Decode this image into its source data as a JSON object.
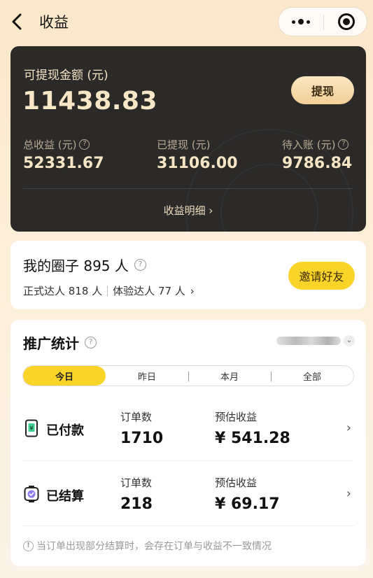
{
  "header": {
    "title": "收益",
    "more_icon": "more-dots-icon",
    "close_icon": "target-icon"
  },
  "earnings": {
    "available_label": "可提现金额 (元)",
    "available_amount": "11438.83",
    "withdraw_label": "提现",
    "stats": [
      {
        "label": "总收益 (元)",
        "value": "52331.67",
        "has_help": true
      },
      {
        "label": "已提现 (元)",
        "value": "31106.00",
        "has_help": false
      },
      {
        "label": "待入账 (元)",
        "value": "9786.84",
        "has_help": true
      }
    ],
    "detail_link": "收益明细 ›"
  },
  "circle": {
    "title": "我的圈子 895 人",
    "official_label": "正式达人 818 人",
    "trial_label": "体验达人 77 人",
    "trial_arrow": "›",
    "invite_label": "邀请好友"
  },
  "promo": {
    "title": "推广统计",
    "tabs": [
      "今日",
      "昨日",
      "本月",
      "全部"
    ],
    "active_tab": 0,
    "rows": [
      {
        "name": "已付款",
        "orders_label": "订单数",
        "orders": "1710",
        "income_label": "预估收益",
        "income": "¥ 541.28",
        "icon": "paid-phone-icon"
      },
      {
        "name": "已结算",
        "orders_label": "订单数",
        "orders": "218",
        "income_label": "预估收益",
        "income": "¥ 69.17",
        "icon": "settled-check-icon"
      }
    ],
    "note": "当订单出现部分结算时，会存在订单与收益不一致情况"
  },
  "colors": {
    "background": "#fbe7c9",
    "dark_card": "#2b2a29",
    "gold_text": "#f6e4c4",
    "accent_yellow": "#fbd42a"
  }
}
